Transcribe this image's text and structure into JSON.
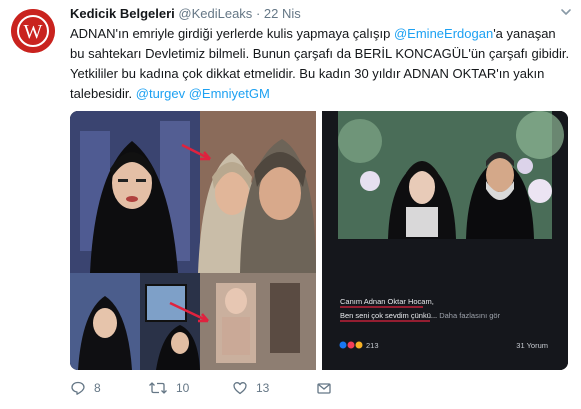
{
  "author": {
    "name": "Kedicik Belgeleri",
    "handle": "@KediLeaks",
    "separator": "·",
    "time": "22 Nis",
    "avatar_letter": "W"
  },
  "tweet": {
    "t1": "ADNAN'ın emriyle girdiği yerlerde kulis yapmaya çalışıp ",
    "m1": "@EmineErdogan",
    "t2": "'a yanaşan bu sahtekarı Devletimiz bilmeli. Bunun çarşafı da  BERİL KONCAGÜL'ün çarşafı gibidir. Yetkililer bu kadına çok dikkat etmelidir. Bu kadın 30 yıldır ADNAN OKTAR'ın yakın talebesidir. ",
    "m2": "@turgev",
    "t3": " ",
    "m3": "@EmniyetGM"
  },
  "media_right": {
    "caption_line1": "Canım Adnan Oktar Hocam,",
    "caption_line2": "Ben seni çok sevdim çünkü...",
    "caption_more": " Daha fazlasını gör",
    "reaction_count": "213",
    "comment_count": "31 Yorum"
  },
  "actions": {
    "replies": "8",
    "retweets": "10",
    "likes": "13"
  },
  "colors": {
    "mention": "#1da1f2",
    "avatar": "#c9231e",
    "secondary_text": "#657786"
  }
}
